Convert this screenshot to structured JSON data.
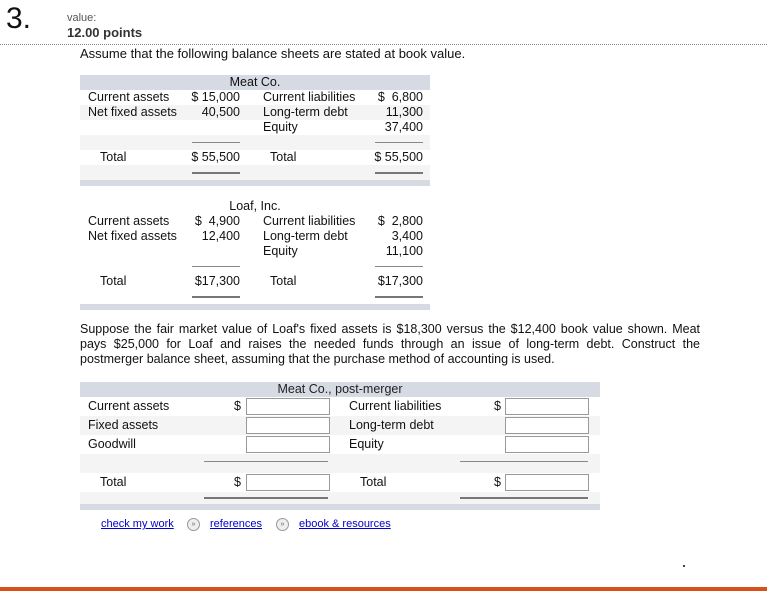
{
  "question": {
    "number": "3.",
    "value_label": "value:",
    "points": "12.00 points",
    "intro": "Assume that the following balance sheets are stated at book value."
  },
  "meat": {
    "title": "Meat Co.",
    "ca_label": "Current assets",
    "ca": "$ 15,000",
    "nfa_label": "Net fixed assets",
    "nfa": "40,500",
    "cl_label": "Current liabilities",
    "cl": "$  6,800",
    "ltd_label": "Long-term debt",
    "ltd": "11,300",
    "eq_label": "Equity",
    "eq": "37,400",
    "total_label": "Total",
    "total_assets": "$ 55,500",
    "total_claims": "$ 55,500"
  },
  "loaf": {
    "title": "Loaf, Inc.",
    "ca_label": "Current assets",
    "ca": "$  4,900",
    "nfa_label": "Net fixed assets",
    "nfa": "12,400",
    "cl_label": "Current liabilities",
    "cl": "$  2,800",
    "ltd_label": "Long-term debt",
    "ltd": "3,400",
    "eq_label": "Equity",
    "eq": "11,100",
    "total_label": "Total",
    "total_assets": "$17,300",
    "total_claims": "$17,300"
  },
  "paragraph": "Suppose the fair market value of Loaf's fixed assets is $18,300 versus the $12,400 book value shown. Meat pays $25,000 for Loaf and raises the needed funds through an issue of long-term debt. Construct the postmerger balance sheet, assuming that the purchase method of accounting is used.",
  "post": {
    "title": "Meat Co., post-merger",
    "ca_label": "Current assets",
    "fa_label": "Fixed assets",
    "gw_label": "Goodwill",
    "cl_label": "Current liabilities",
    "ltd_label": "Long-term debt",
    "eq_label": "Equity",
    "total_label": "Total",
    "dollar": "$",
    "values": {
      "ca": "",
      "fa": "",
      "gw": "",
      "cl": "",
      "ltd": "",
      "eq": "",
      "ta": "",
      "tc": ""
    }
  },
  "links": {
    "check": "check my work",
    "references": "references",
    "ebook": "ebook & resources",
    "expand_icon": "»"
  },
  "colors": {
    "header": "#d6dae3",
    "accent_bar": "#d8501c",
    "link": "#0000cc"
  }
}
